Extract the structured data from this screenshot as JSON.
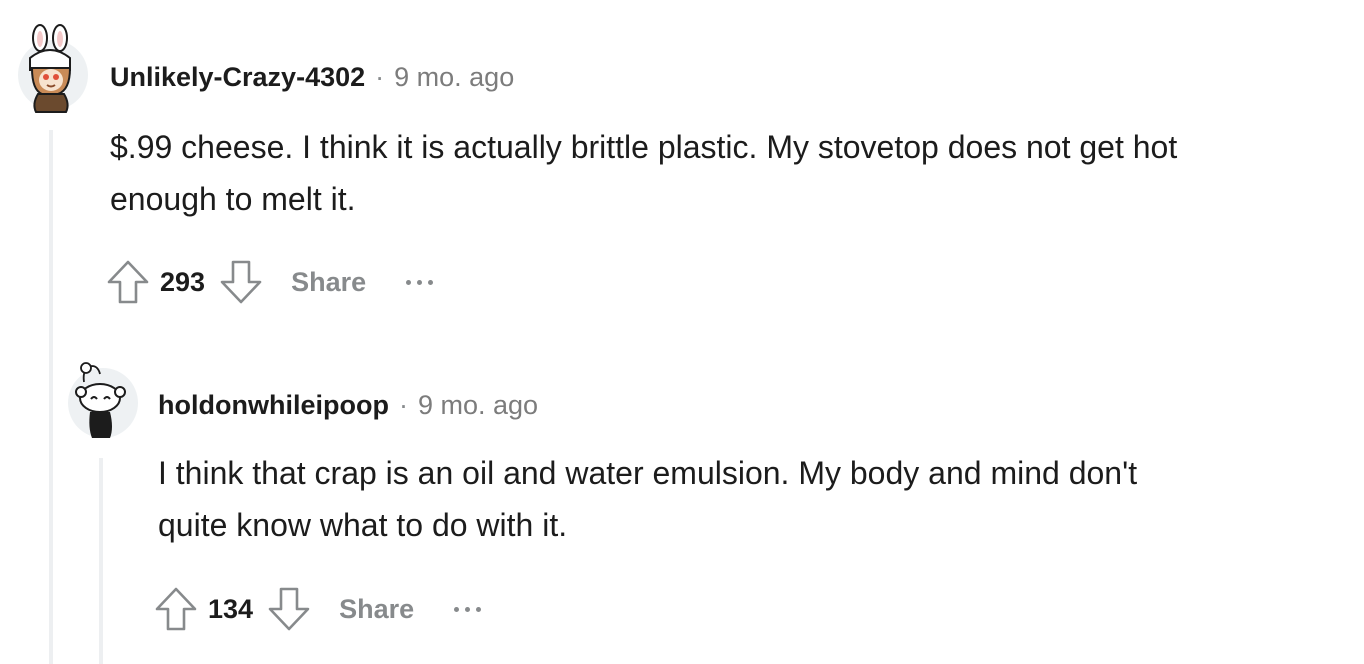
{
  "comments": [
    {
      "username": "Unlikely-Crazy-4302",
      "separator": "·",
      "time": "9 mo. ago",
      "body_lines": [
        "$.99 cheese. I think it is actually brittle plastic. My stovetop does not get hot",
        "enough to melt it."
      ],
      "score": "293",
      "share_label": "Share",
      "avatar_icon": "bunny-hood-avatar-icon"
    },
    {
      "username": "holdonwhileipoop",
      "separator": "·",
      "time": "9 mo. ago",
      "body_lines": [
        "I think that crap is an oil and water emulsion. My body and mind don't",
        "quite know what to do with it."
      ],
      "score": "134",
      "share_label": "Share",
      "avatar_icon": "default-snoo-avatar-icon"
    }
  ],
  "colors": {
    "text": "#1c1c1c",
    "meta": "#7c7c7c",
    "icon": "#878a8c",
    "thread_line": "#edeff1",
    "avatar_bg": "#eef1f3"
  }
}
